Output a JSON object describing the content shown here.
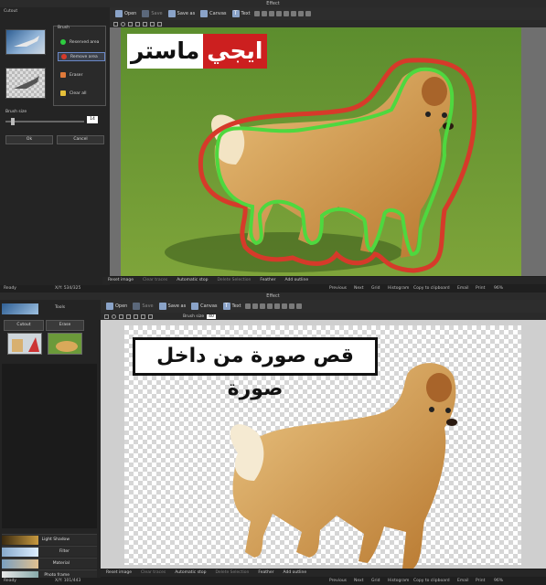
{
  "top": {
    "window_title": "Effect",
    "toolbar": {
      "open": "Open",
      "save": "Save",
      "save_as": "Save as",
      "canvas": "Canvas",
      "text": "Text"
    },
    "left": {
      "cutout_label": "Cutout",
      "brush_label": "Brush",
      "reserved_area": "Reserved area",
      "remove_area": "Remove area",
      "eraser": "Eraser",
      "clear_all": "Clear all",
      "brush_size_label": "Brush size",
      "brush_size_value": "14",
      "ok": "Ok",
      "cancel": "Cancel"
    },
    "logo": {
      "red_word": "ايجي",
      "white_word": "ماستر"
    },
    "bottom_bar": {
      "reset_image": "Reset image",
      "clear_traces": "Clear traces",
      "automatic_stop": "Automatic stop",
      "delete_selection": "Delete Selection",
      "feather": "Feather",
      "add_outline": "Add outline"
    },
    "status": {
      "ready": "Ready",
      "coords": "X/Y: 534/325",
      "previous": "Previous",
      "next": "Next",
      "grid": "Grid",
      "histogram": "Histogram",
      "copy": "Copy to clipboard",
      "email": "Email",
      "print": "Print",
      "zoom": "96%"
    }
  },
  "bottom": {
    "window_title": "Effect",
    "toolbar": {
      "open": "Open",
      "save": "Save",
      "save_as": "Save as",
      "canvas": "Canvas",
      "text": "Text",
      "brush_size_label": "Brush size",
      "brush_size_value": "40"
    },
    "left": {
      "tools": "Tools",
      "cutout": "Cutout",
      "erase": "Erase",
      "light_shadow": "Light Shadow",
      "filter": "Filter",
      "material": "Material",
      "photo_frame": "Photo frame"
    },
    "caption": "قص صورة من داخل صورة",
    "bottom_bar": {
      "reset_image": "Reset image",
      "clear_traces": "Clear traces",
      "automatic_stop": "Automatic stop",
      "delete_selection": "Delete Selection",
      "feather": "Feather",
      "add_outline": "Add outline"
    },
    "status": {
      "ready": "Ready",
      "coords": "X/Y: 101/443",
      "previous": "Previous",
      "next": "Next",
      "grid": "Grid",
      "histogram": "Histogram",
      "copy": "Copy to clipboard",
      "email": "Email",
      "print": "Print",
      "zoom": "96%"
    }
  },
  "colors": {
    "reserved": "#2ecc40",
    "remove": "#d63a2a",
    "eraser": "#e07a3a",
    "clear": "#e6c03a"
  }
}
